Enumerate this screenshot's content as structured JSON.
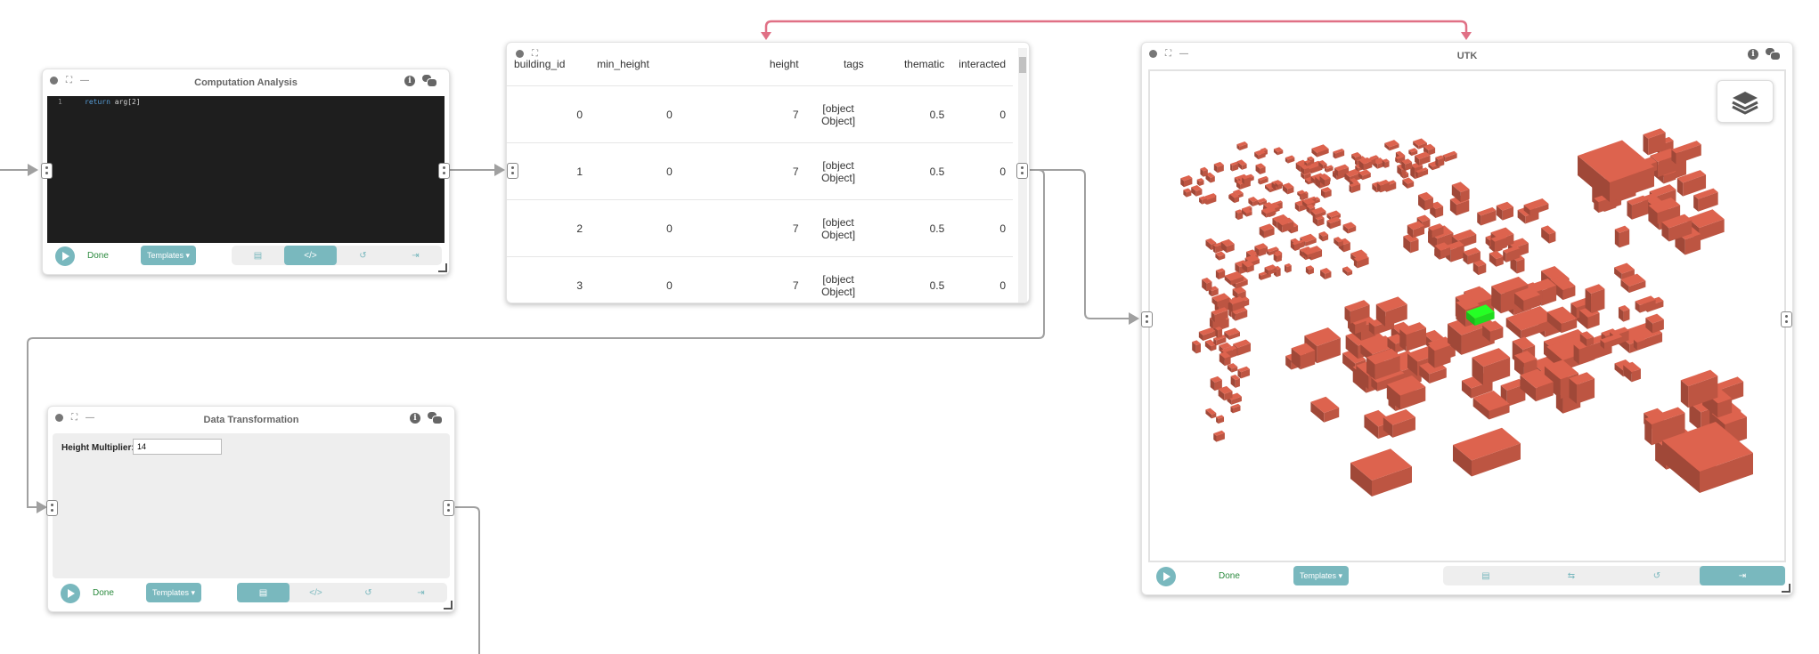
{
  "colors": {
    "accent": "#79b8be",
    "edge": "#a0a0a0",
    "edge_highlight": "#e07085",
    "building": "#cd5c48",
    "building_selected": "#22ee22",
    "editor_bg": "#1e1e1e"
  },
  "computation": {
    "title": "Computation Analysis",
    "line_number": "1",
    "code_keyword": "return",
    "code_rest": " arg[2]",
    "done_label": "Done",
    "templates_label": "Templates ▾",
    "toolbar_icons": [
      "briefcase-icon",
      "code-icon",
      "undo-icon",
      "sign-out-icon"
    ]
  },
  "table": {
    "columns": [
      "building_id",
      "min_height",
      "height",
      "tags",
      "thematic",
      "interacted"
    ],
    "rows": [
      [
        "0",
        "0",
        "7",
        "[object Object]",
        "0.5",
        "0"
      ],
      [
        "1",
        "0",
        "7",
        "[object Object]",
        "0.5",
        "0"
      ],
      [
        "2",
        "0",
        "7",
        "[object Object]",
        "0.5",
        "0"
      ],
      [
        "3",
        "0",
        "7",
        "[object Object]",
        "0.5",
        "0"
      ]
    ]
  },
  "utk": {
    "title": "UTK",
    "done_label": "Done",
    "templates_label": "Templates ▾",
    "layers_icon": "layers-icon"
  },
  "transform": {
    "title": "Data Transformation",
    "field_label": "Height Multiplier:",
    "field_value": "14",
    "done_label": "Done",
    "templates_label": "Templates ▾"
  }
}
